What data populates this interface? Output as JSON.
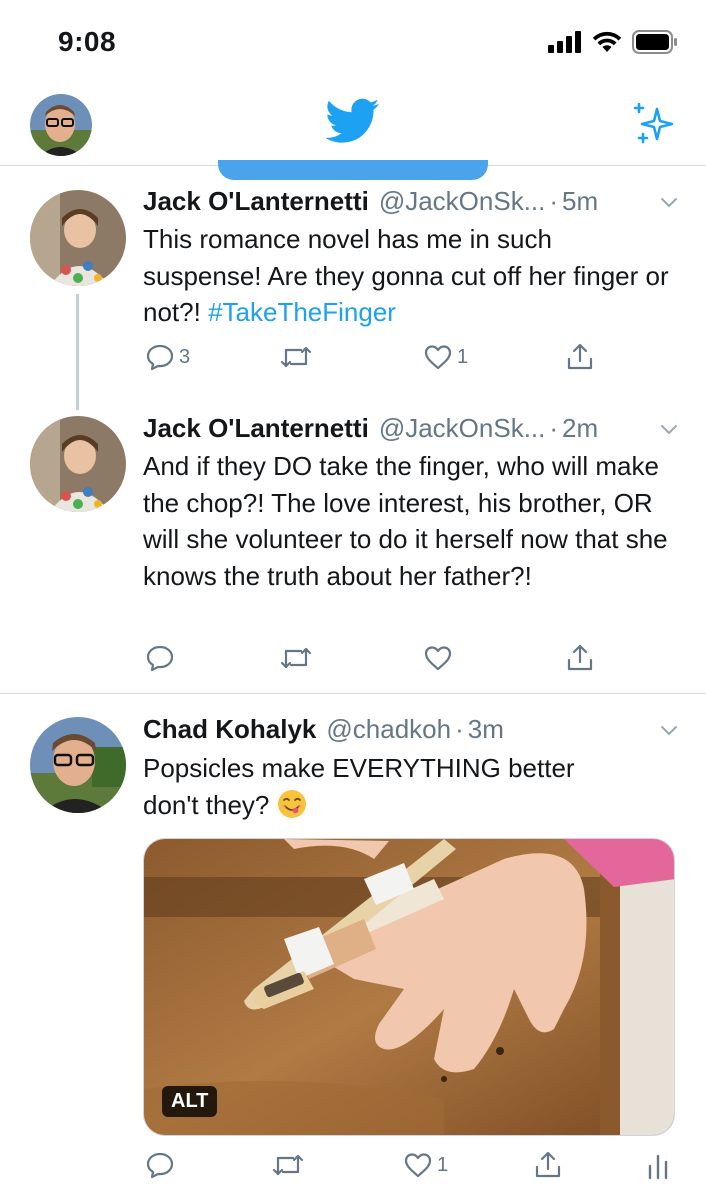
{
  "status_bar": {
    "time": "9:08"
  },
  "nav": {
    "avatar_icon": "profile-avatar",
    "logo_icon": "twitter-bird-icon",
    "sparkle_icon": "sparkle-icon",
    "brand_color": "#1da1f2"
  },
  "tweets": [
    {
      "name": "Jack O'Lanternetti",
      "handle": "@JackOnSk...",
      "time": "5m",
      "text": "This romance novel has me in such suspense! Are they gonna cut off her finger or not?!",
      "hashtag": "#TakeTheFinger",
      "replies": "3",
      "retweets": "",
      "likes": "1"
    },
    {
      "name": "Jack O'Lanternetti",
      "handle": "@JackOnSk...",
      "time": "2m",
      "text": "And if they DO take the finger, who will make the chop?! The love interest, his brother, OR will she volunteer to do it herself now that she knows the truth about her father?!",
      "replies": "",
      "retweets": "",
      "likes": ""
    },
    {
      "name": "Chad Kohalyk",
      "handle": "@chadkoh",
      "time": "3m",
      "text": "Popsicles make EVERYTHING better don't they?",
      "emoji": "yum-face-emoji",
      "media_alt_badge": "ALT",
      "replies": "",
      "retweets": "",
      "likes": "1"
    }
  ],
  "colors": {
    "text": "#14171a",
    "secondary": "#657786",
    "link": "#1da1f2",
    "divider": "#d9dde1"
  }
}
